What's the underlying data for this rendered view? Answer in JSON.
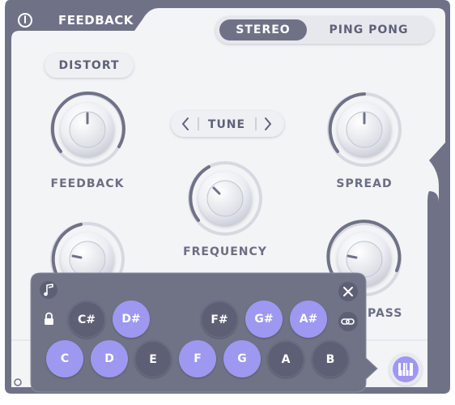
{
  "header": {
    "title": "FEEDBACK",
    "mode_options": [
      "STEREO",
      "PING PONG"
    ],
    "mode_selected": "STEREO"
  },
  "controls": {
    "distort_label": "DISTORT",
    "tune_label": "TUNE",
    "tune_prev": "<",
    "tune_next": ">"
  },
  "knobs": {
    "feedback": "FEEDBACK",
    "spread": "SPREAD",
    "frequency": "FREQUENCY",
    "pass_partial": "PASS"
  },
  "keyboard": {
    "sharps": [
      {
        "note": "C#",
        "active": false
      },
      {
        "note": "D#",
        "active": true
      },
      {
        "note": "F#",
        "active": false
      },
      {
        "note": "G#",
        "active": true
      },
      {
        "note": "A#",
        "active": true
      }
    ],
    "naturals": [
      {
        "note": "C",
        "active": true
      },
      {
        "note": "D",
        "active": true
      },
      {
        "note": "E",
        "active": false
      },
      {
        "note": "F",
        "active": true
      },
      {
        "note": "G",
        "active": true
      },
      {
        "note": "A",
        "active": false
      },
      {
        "note": "B",
        "active": false
      }
    ]
  },
  "colors": {
    "panel_dark": "#6f7287",
    "panel_light": "#f3f4f6",
    "accent": "#9e98f1",
    "popup_bg": "#707386",
    "label_text": "#6b6e84"
  },
  "icons": {
    "power": "power-icon",
    "music_note": "music-note-icon",
    "lock": "lock-icon",
    "close": "close-icon",
    "link": "link-icon",
    "piano": "piano-keys-icon"
  }
}
